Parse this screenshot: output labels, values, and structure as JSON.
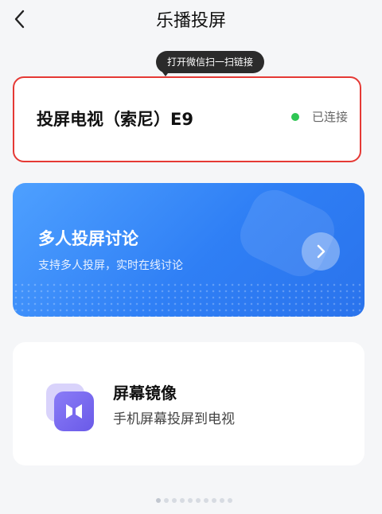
{
  "header": {
    "title": "乐播投屏",
    "back_icon": "back-arrow-icon"
  },
  "tooltip": {
    "text": "打开微信扫一扫链接"
  },
  "device_card": {
    "name": "投屏电视（索尼）E9",
    "status": "已连接",
    "status_color": "#2ec653",
    "highlight_color": "#e53935"
  },
  "multi_card": {
    "title": "多人投屏讨论",
    "subtitle": "支持多人投屏，实时在线讨论",
    "arrow_icon": "chevron-right-icon",
    "accent": "#2f7ff5"
  },
  "mirror_card": {
    "title": "屏幕镜像",
    "subtitle": "手机屏幕投屏到电视",
    "icon": "screen-mirror-icon",
    "accent": "#6a5ae8"
  },
  "pager": {
    "count": 10,
    "active": 0
  }
}
